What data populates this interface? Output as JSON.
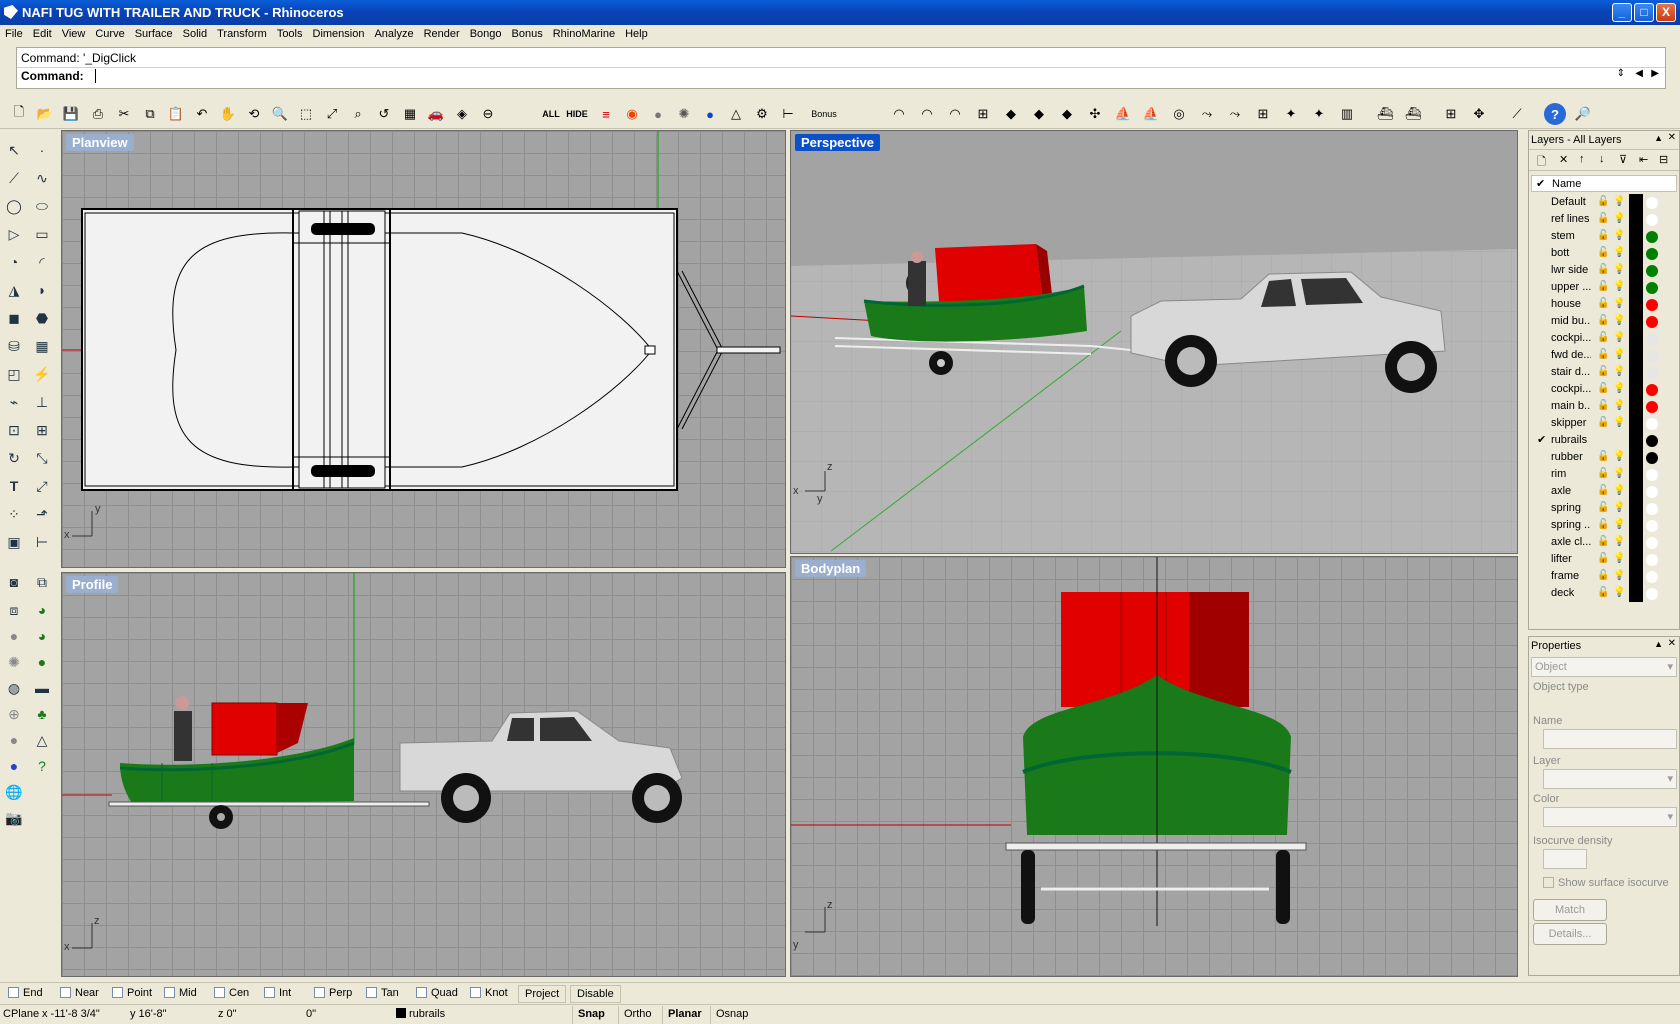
{
  "window": {
    "title": "NAFI TUG WITH TRAILER AND TRUCK - Rhinoceros",
    "min": "_",
    "max": "□",
    "close": "X"
  },
  "menu": [
    "File",
    "Edit",
    "View",
    "Curve",
    "Surface",
    "Solid",
    "Transform",
    "Tools",
    "Dimension",
    "Analyze",
    "Render",
    "Bongo",
    "Bonus",
    "RhinoMarine",
    "Help"
  ],
  "command": {
    "history": "Command: '_DigClick",
    "prompt": "Command:"
  },
  "toolbar": {
    "all_label": "ALL",
    "hide_label": "HIDE",
    "bonus_label": "Bonus"
  },
  "viewports": {
    "planview": {
      "title": "Planview"
    },
    "perspective": {
      "title": "Perspective"
    },
    "profile": {
      "title": "Profile"
    },
    "bodyplan": {
      "title": "Bodyplan"
    }
  },
  "axis_labels": {
    "x": "x",
    "y": "y",
    "z": "z"
  },
  "layers": {
    "title": "Layers - All Layers",
    "column_name": "Name",
    "items": [
      {
        "name": "Default",
        "color": "#ffffff",
        "current": false
      },
      {
        "name": "ref lines",
        "color": "#ffffff",
        "current": false
      },
      {
        "name": "stem",
        "color": "#008000",
        "current": false
      },
      {
        "name": "bott",
        "color": "#008000",
        "current": false
      },
      {
        "name": "lwr side",
        "color": "#008000",
        "current": false
      },
      {
        "name": "upper ...",
        "color": "#008000",
        "current": false
      },
      {
        "name": "house",
        "color": "#ff0000",
        "current": false
      },
      {
        "name": "mid bu...",
        "color": "#ff0000",
        "current": false
      },
      {
        "name": "cockpi...",
        "color": "#e6e6e6",
        "current": false
      },
      {
        "name": "fwd de...",
        "color": "#e6e6e6",
        "current": false
      },
      {
        "name": "stair d...",
        "color": "#e6e6e6",
        "current": false
      },
      {
        "name": "cockpi...",
        "color": "#ff0000",
        "current": false
      },
      {
        "name": "main b...",
        "color": "#ff0000",
        "current": false
      },
      {
        "name": "skipper",
        "color": "#ffffff",
        "current": false
      },
      {
        "name": "rubrails",
        "color": "#000000",
        "current": true
      },
      {
        "name": "rubber",
        "color": "#000000",
        "current": false
      },
      {
        "name": "rim",
        "color": "#ffffff",
        "current": false
      },
      {
        "name": "axle",
        "color": "#ffffff",
        "current": false
      },
      {
        "name": "spring",
        "color": "#ffffff",
        "current": false
      },
      {
        "name": "spring ...",
        "color": "#ffffff",
        "current": false
      },
      {
        "name": "axle cl...",
        "color": "#ffffff",
        "current": false
      },
      {
        "name": "lifter",
        "color": "#ffffff",
        "current": false
      },
      {
        "name": "frame",
        "color": "#ffffff",
        "current": false
      },
      {
        "name": "deck",
        "color": "#ffffff",
        "current": false
      }
    ]
  },
  "properties": {
    "title": "Properties",
    "selector": "Object",
    "object_type": "Object type",
    "name_label": "Name",
    "layer_label": "Layer",
    "color_label": "Color",
    "isocurve_label": "Isocurve density",
    "show_isocurve": "Show surface isocurve",
    "match_button": "Match",
    "details_button": "Details..."
  },
  "osnaps": {
    "items": [
      "End",
      "Near",
      "Point",
      "Mid",
      "Cen",
      "Int",
      "Perp",
      "Tan",
      "Quad",
      "Knot"
    ],
    "project": "Project",
    "disable": "Disable"
  },
  "status": {
    "cplane": "CPlane",
    "x": "x -11'-8 3/4\"",
    "y": "y 16'-8\"",
    "z": "z 0\"",
    "dist": "0\"",
    "layer": "rubrails",
    "snap": "Snap",
    "ortho": "Ortho",
    "planar": "Planar",
    "osnap": "Osnap"
  },
  "colors": {
    "hull_green": "#1a7a1a",
    "house_red": "#e00000",
    "viewport_bg": "#a3a3a3",
    "title_blue": "#0a50c8"
  }
}
